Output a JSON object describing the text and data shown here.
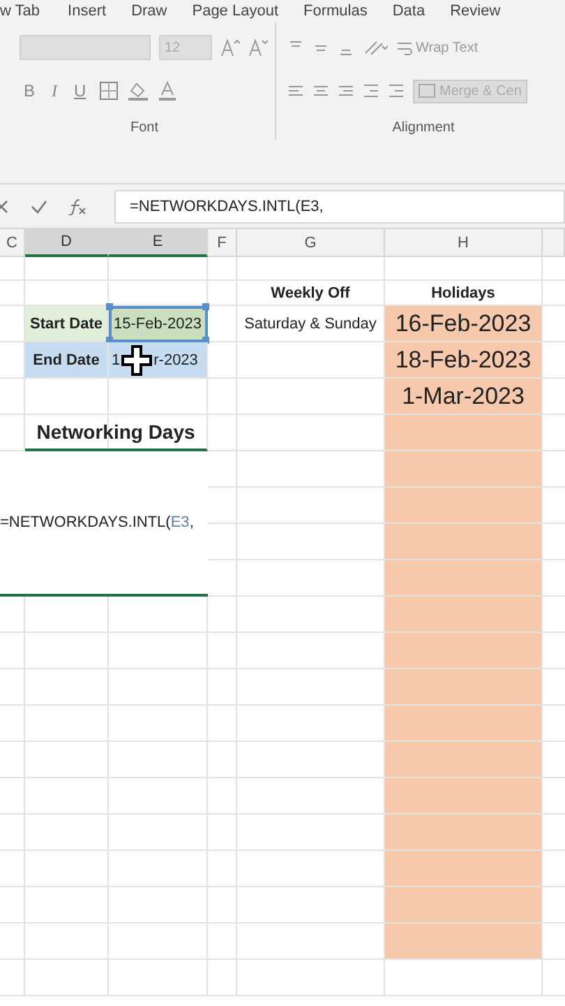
{
  "ribbon": {
    "tabs": [
      {
        "label": "w Tab"
      },
      {
        "label": "Insert"
      },
      {
        "label": "Draw"
      },
      {
        "label": "Page Layout"
      },
      {
        "label": "Formulas"
      },
      {
        "label": "Data"
      },
      {
        "label": "Review"
      }
    ],
    "font_group": {
      "font_size": "12",
      "format_buttons": [
        "B",
        "I",
        "U"
      ],
      "label": "Font"
    },
    "alignment_group": {
      "wrap_text": "Wrap Text",
      "merge": "Merge & Cen",
      "label": "Alignment"
    }
  },
  "formula_bar": {
    "formula": "=NETWORKDAYS.INTL(E3,"
  },
  "sheet": {
    "columns": [
      {
        "label": "C",
        "selected": false
      },
      {
        "label": "D",
        "selected": true
      },
      {
        "label": "E",
        "selected": true
      },
      {
        "label": "F",
        "selected": false
      },
      {
        "label": "G",
        "selected": false
      },
      {
        "label": "H",
        "selected": false
      }
    ],
    "rows": [
      {},
      {
        "G": {
          "kind": "label",
          "text": "Weekly Off",
          "selected": false
        },
        "H": {
          "kind": "label",
          "text": "Holidays",
          "selected": false
        }
      },
      {
        "D": {
          "kind": "label",
          "text": "Start Date",
          "color": "#e2efda",
          "selected": false
        },
        "E": {
          "kind": "value",
          "text": "15-Feb-2023",
          "color": "#c9dfbd",
          "selected": true
        },
        "G": {
          "kind": "value",
          "text": "Saturday & Sunday",
          "selected": false
        },
        "H": {
          "kind": "holiday",
          "text": "16-Feb-2023",
          "color": "#f6c9ad",
          "selected": false
        }
      },
      {
        "D": {
          "kind": "label",
          "text": "End Date",
          "color": "#c6dcf0",
          "selected": false
        },
        "E": {
          "kind": "covered",
          "text_start": "1",
          "text_end": "r-2023",
          "color": "#c6dcf0",
          "selected": false
        },
        "H": {
          "kind": "holiday",
          "text": "18-Feb-2023",
          "color": "#f6c9ad",
          "selected": false
        }
      },
      {
        "H": {
          "kind": "holiday",
          "text": "1-Mar-2023",
          "color": "#f6c9ad",
          "selected": false
        }
      },
      {
        "D:E": {
          "kind": "title",
          "text": "Networking Days",
          "selected": false
        },
        "H": {
          "color": "#f6c9ad",
          "selected": false
        }
      },
      {
        "H": {
          "color": "#f6c9ad",
          "selected": false
        }
      },
      {
        "H": {
          "color": "#f6c9ad",
          "selected": false
        }
      },
      {
        "H": {
          "color": "#f6c9ad",
          "selected": false
        }
      },
      {
        "H": {
          "color": "#f6c9ad",
          "selected": false
        }
      },
      {
        "H": {
          "color": "#f6c9ad",
          "selected": false
        }
      },
      {
        "H": {
          "color": "#f6c9ad",
          "selected": false
        }
      },
      {
        "H": {
          "color": "#f6c9ad",
          "selected": false
        }
      },
      {
        "H": {
          "color": "#f6c9ad",
          "selected": false
        }
      },
      {
        "H": {
          "color": "#f6c9ad",
          "selected": false
        }
      },
      {
        "H": {
          "color": "#f6c9ad",
          "selected": false
        }
      },
      {
        "H": {
          "color": "#f6c9ad",
          "selected": false
        }
      },
      {
        "H": {
          "color": "#f6c9ad",
          "selected": false
        }
      },
      {
        "H": {
          "color": "#f6c9ad",
          "selected": false
        }
      },
      {
        "H": {
          "color": "#f6c9ad",
          "selected": false
        }
      },
      {}
    ],
    "editor": {
      "text": "=NETWORKDAYS.INTL(",
      "reference": "E3",
      "tail": ","
    }
  }
}
